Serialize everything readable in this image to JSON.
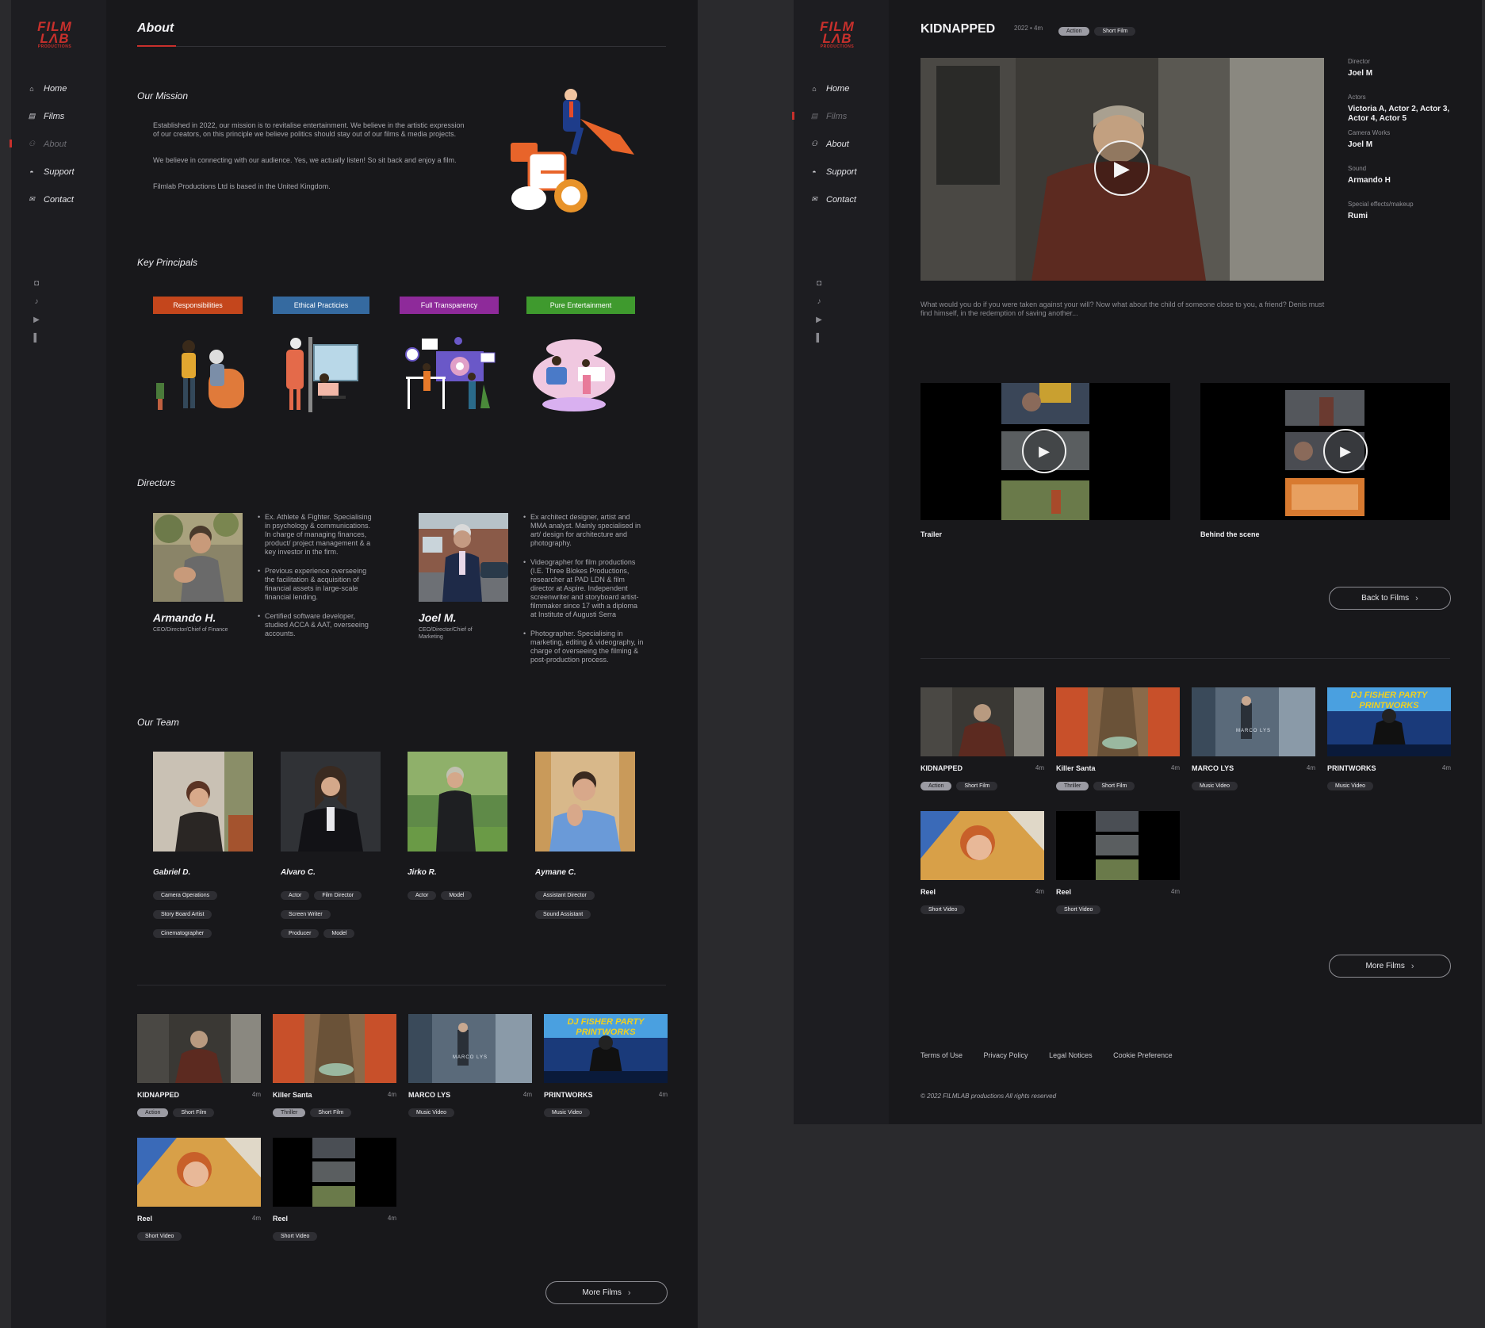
{
  "brand": {
    "logo_line1": "FILM",
    "logo_line2": "LΛB",
    "logo_sub": "PRODUCTIONS",
    "accent": "#c8302c"
  },
  "nav": {
    "items": [
      {
        "label": "Home",
        "icon": "home-icon"
      },
      {
        "label": "Films",
        "icon": "film-icon"
      },
      {
        "label": "About",
        "icon": "users-icon"
      },
      {
        "label": "Support",
        "icon": "handshake-icon"
      },
      {
        "label": "Contact",
        "icon": "mail-icon"
      }
    ],
    "social_icons": [
      "instagram-icon",
      "tiktok-icon",
      "youtube-icon",
      "patreon-icon"
    ]
  },
  "about": {
    "title": "About",
    "mission": {
      "heading": "Our Mission",
      "paragraphs": [
        "Established in 2022, our mission is to revitalise entertainment. We believe in the artistic expression of our creators, on this principle we believe politics should stay out of our films & media projects.",
        "We believe in connecting with our audience. Yes, we actually listen! So sit back and enjoy a film.",
        "Filmlab Productions Ltd is based in the United Kingdom."
      ]
    },
    "principles": {
      "heading": "Key Principals",
      "items": [
        {
          "label": "Responsibilities",
          "color": "#c4461c"
        },
        {
          "label": "Ethical Practicies",
          "color": "#356aa0"
        },
        {
          "label": "Full Transparency",
          "color": "#8e2a9a"
        },
        {
          "label": "Pure Entertainment",
          "color": "#3f9a2e"
        }
      ]
    },
    "directors": {
      "heading": "Directors",
      "items": [
        {
          "name": "Armando H.",
          "role": "CEO/Director/Chief of Finance",
          "bullets": [
            "Ex. Athlete & Fighter. Specialising in psychology & communications. In charge of managing finances, product/ project management & a key investor in the firm.",
            "Previous experience overseeing the facilitation & acquisition of financial assets in large-scale financial lending.",
            "Certified software developer, studied ACCA & AAT, overseeing accounts."
          ]
        },
        {
          "name": "Joel M.",
          "role": "CEO/Director/Chief of Marketing",
          "bullets": [
            "Ex architect designer, artist and MMA analyst. Mainly specialised in art/ design for architecture and photography.",
            "Videographer for film productions (I.E. Three Blokes Productions, researcher at PAD LDN & film director at Aspire. Independent screenwriter and storyboard artist-filmmaker since 17 with a diploma at Institute of Augusti Serra",
            "Photographer. Specialising in marketing, editing & videography, in charge of overseeing the filming & post-production process."
          ]
        }
      ]
    },
    "team": {
      "heading": "Our Team",
      "members": [
        {
          "name": "Gabriel D.",
          "tags": [
            "Camera Operations",
            "Story Board Artist",
            "Cinematographer"
          ]
        },
        {
          "name": "Alvaro C.",
          "tags": [
            "Actor",
            "Film Director",
            "Screen Writer",
            "Producer",
            "Model"
          ]
        },
        {
          "name": "Jirko R.",
          "tags": [
            "Actor",
            "Model"
          ]
        },
        {
          "name": "Aymane C.",
          "tags": [
            "Assistant Director",
            "Sound Assistant"
          ]
        }
      ]
    }
  },
  "films": [
    {
      "title": "KIDNAPPED",
      "duration": "4m",
      "tags": [
        "Action",
        "Short Film"
      ],
      "thumb": "alley"
    },
    {
      "title": "Killer Santa",
      "duration": "4m",
      "tags": [
        "Thriller",
        "Short Film"
      ],
      "thumb": "tree"
    },
    {
      "title": "MARCO LYS",
      "duration": "4m",
      "tags": [
        "Music Video"
      ],
      "thumb": "corridor",
      "overlay": "MARCO LYS"
    },
    {
      "title": "PRINTWORKS",
      "duration": "4m",
      "tags": [
        "Music Video"
      ],
      "thumb": "dj",
      "overlay": "DJ FISHER PARTY PRINTWORKS"
    },
    {
      "title": "Reel",
      "duration": "4m",
      "tags": [
        "Short Video"
      ],
      "thumb": "portrait"
    },
    {
      "title": "Reel",
      "duration": "4m",
      "tags": [
        "Short Video"
      ],
      "thumb": "collage"
    }
  ],
  "more_films_label": "More Films",
  "film_detail": {
    "title": "KIDNAPPED",
    "meta": "2022 • 4m",
    "tags": [
      "Action",
      "Short Film"
    ],
    "credits": [
      {
        "label": "Director",
        "value": "Joel M"
      },
      {
        "label": "Actors",
        "value": "Victoria A, Actor 2, Actor 3, Actor 4, Actor 5"
      },
      {
        "label": "Camera Works",
        "value": "Joel M"
      },
      {
        "label": "Sound",
        "value": "Armando H"
      },
      {
        "label": "Special effects/makeup",
        "value": "Rumi"
      }
    ],
    "synopsis": "What would you do if you were taken against your will? Now what about the child of someone close to you, a friend? Denis must find himself, in the redemption of saving another...",
    "extras": [
      {
        "label": "Trailer"
      },
      {
        "label": "Behind the scene"
      }
    ],
    "back_label": "Back to Films"
  },
  "footer": {
    "links": [
      "Terms of Use",
      "Privacy Policy",
      "Legal Notices",
      "Cookie Preference"
    ],
    "copyright": "© 2022 FILMLAB productions All rights reserved"
  }
}
